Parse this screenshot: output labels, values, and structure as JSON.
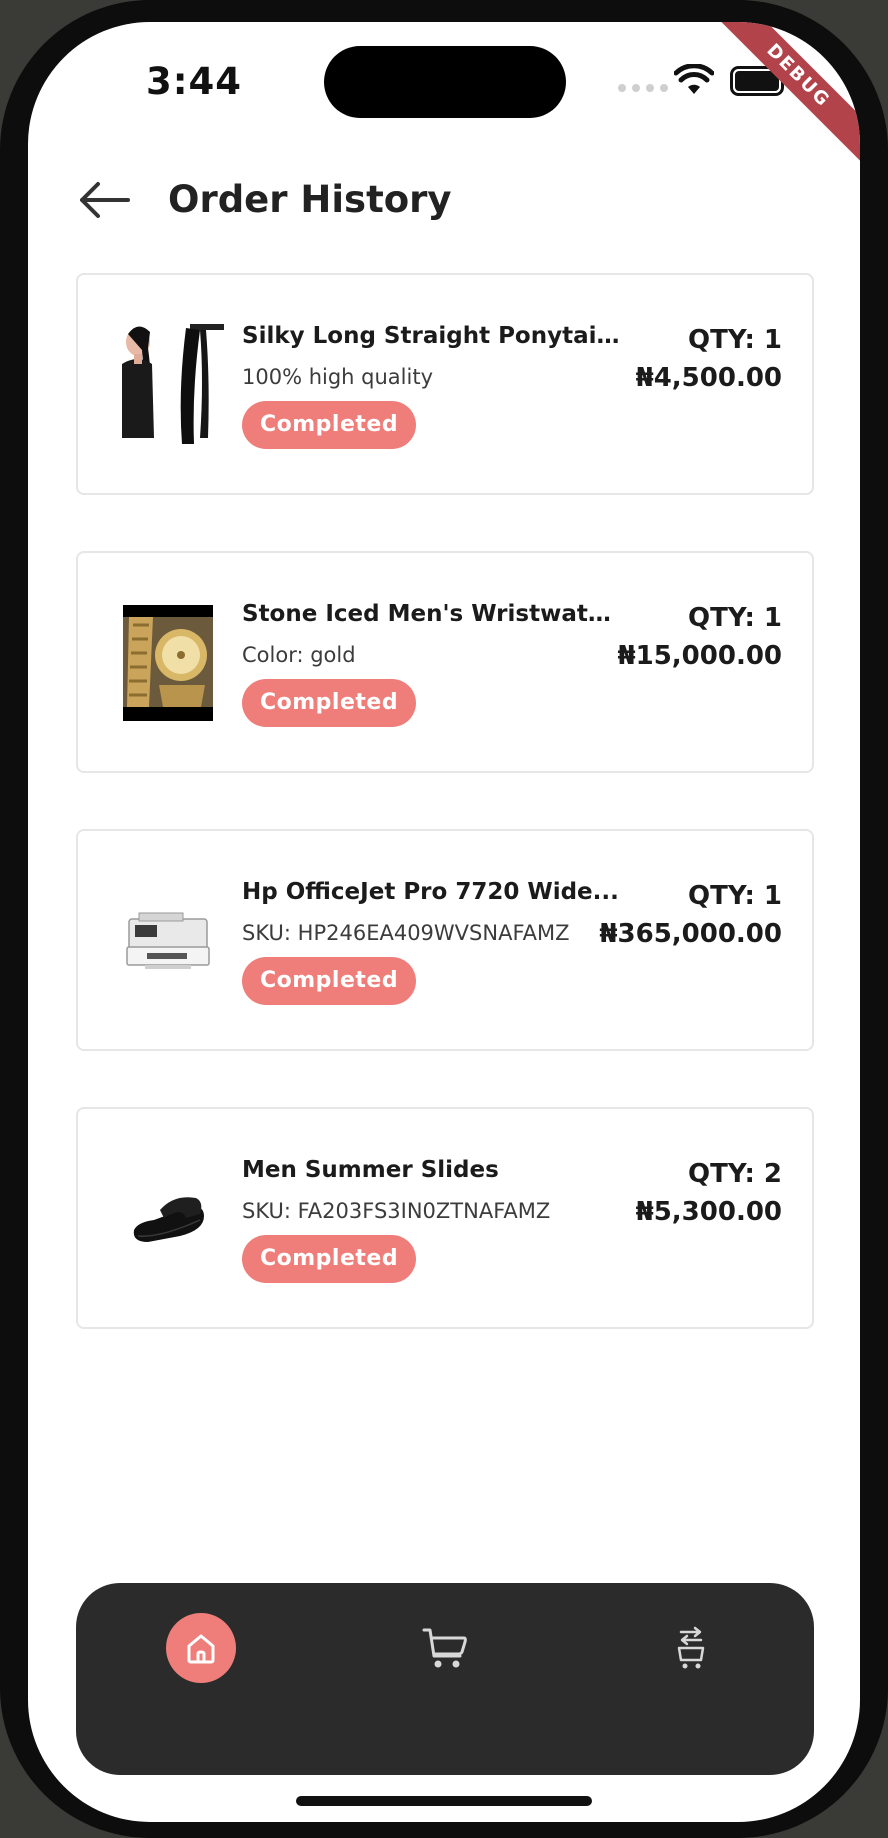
{
  "status_bar": {
    "time": "3:44",
    "debug_label": "DEBUG"
  },
  "header": {
    "title": "Order History",
    "back_icon": "arrow-left-icon"
  },
  "orders": [
    {
      "name": "Silky Long Straight Ponytail ...",
      "subtitle": "100% high quality",
      "status": "Completed",
      "qty": "QTY: 1",
      "price": "₦4,500.00",
      "image": "ponytail-hair-image"
    },
    {
      "name": "Stone Iced Men's Wristwatch...",
      "subtitle": "Color: gold",
      "status": "Completed",
      "qty": "QTY: 1",
      "price": "₦15,000.00",
      "image": "gold-wristwatch-image"
    },
    {
      "name": "Hp OfficeJet Pro 7720 Wide...",
      "subtitle": "SKU: HP246EA409WVSNAFAMZ",
      "status": "Completed",
      "qty": "QTY: 1",
      "price": "₦365,000.00",
      "image": "printer-image"
    },
    {
      "name": "Men Summer Slides",
      "subtitle": "SKU: FA203FS3IN0ZTNAFAMZ",
      "status": "Completed",
      "qty": "QTY: 2",
      "price": "₦5,300.00",
      "image": "slides-image"
    }
  ],
  "bottom_nav": {
    "items": [
      {
        "icon": "home-icon",
        "active": true
      },
      {
        "icon": "cart-icon",
        "active": false
      },
      {
        "icon": "cart-transfer-icon",
        "active": false
      }
    ]
  },
  "colors": {
    "accent": "#ef7e7a",
    "nav_background": "#2b2b2b",
    "debug_ribbon": "#b3434a"
  }
}
